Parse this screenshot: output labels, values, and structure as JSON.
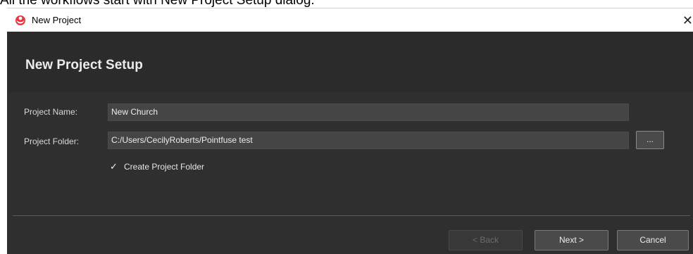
{
  "caption": "All the workflows start with New Project Setup dialog.",
  "window": {
    "title": "New Project",
    "close_glyph": "✕",
    "icon": "pointfuse-logo-icon"
  },
  "dialog": {
    "heading": "New Project Setup",
    "project_name_label": "Project Name:",
    "project_name_value": "New Church",
    "project_folder_label": "Project Folder:",
    "project_folder_value": "C:/Users/CecilyRoberts/Pointfuse test",
    "browse_label": "...",
    "create_folder_label": "Create Project Folder",
    "create_folder_checked": true,
    "check_glyph": "✓"
  },
  "buttons": {
    "back": "< Back",
    "next": "Next >",
    "cancel": "Cancel"
  },
  "colors": {
    "window_bg": "#2f2f2f",
    "field_bg": "#454545",
    "accent_logo": "#e8343f"
  }
}
